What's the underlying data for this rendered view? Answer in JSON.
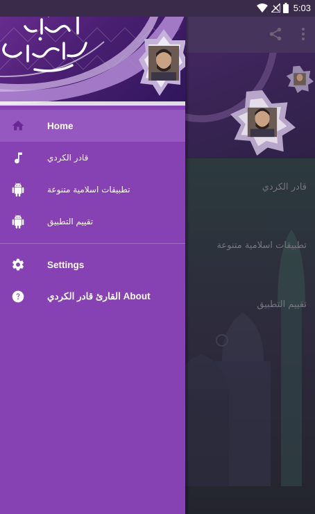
{
  "status_bar": {
    "time": "5:03",
    "icons": [
      "wifi-icon",
      "no-signal-icon",
      "battery-icon"
    ]
  },
  "drawer": {
    "header": {
      "calligraphy_text": "إستماع القرآن الكريم",
      "portrait": "reciter-portrait"
    },
    "items": [
      {
        "label": "Home",
        "icon": "home-icon",
        "active": true
      },
      {
        "label": "قادر الكردي",
        "icon": "music-note-icon",
        "active": false
      },
      {
        "label": "تطبيقات اسلامية متنوعة",
        "icon": "android-icon",
        "active": false
      },
      {
        "label": "تقييم التطبيق",
        "icon": "android-icon",
        "active": false
      }
    ],
    "secondary_items": [
      {
        "label": "Settings",
        "icon": "gear-icon"
      },
      {
        "label": "القارئ قادر الكردي About",
        "icon": "help-icon"
      }
    ]
  },
  "background_app": {
    "toolbar_icons": [
      "share-icon",
      "more-vert-icon"
    ],
    "list_items": [
      "قادر الكردي",
      "تطبيقات اسلامية متنوعة",
      "تقييم التطبيق"
    ]
  },
  "colors": {
    "drawer_bg": "#8641b2",
    "active_item_bg": "#9558c0",
    "header_purple": "#4a1f72",
    "icon_color": "#7b2f9e",
    "text": "#ffffff"
  }
}
